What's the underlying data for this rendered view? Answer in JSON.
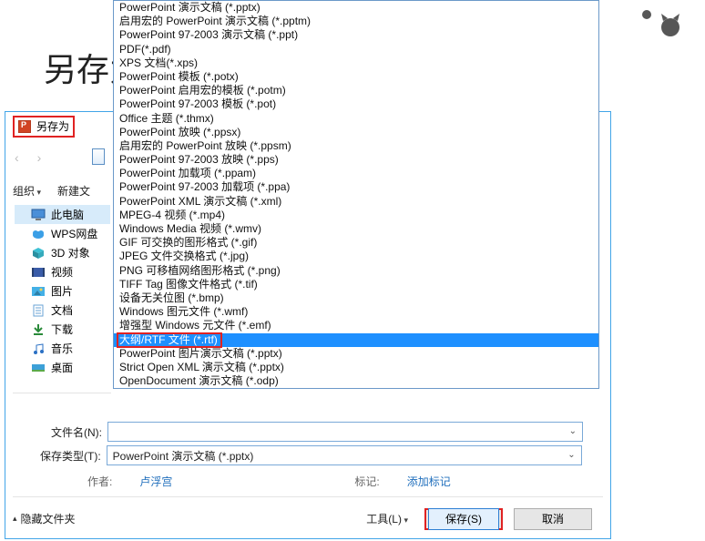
{
  "title": "另存为",
  "header_label": "另存为",
  "nav": {
    "back": "‹",
    "fwd": "›"
  },
  "toolbar": {
    "organize": "组织",
    "newfolder": "新建文"
  },
  "sidebar": [
    {
      "label": "此电脑",
      "icon": "pc"
    },
    {
      "label": "WPS网盘",
      "icon": "cloud"
    },
    {
      "label": "3D 对象",
      "icon": "cube"
    },
    {
      "label": "视频",
      "icon": "vid"
    },
    {
      "label": "图片",
      "icon": "pic"
    },
    {
      "label": "文档",
      "icon": "doc"
    },
    {
      "label": "下载",
      "icon": "dl"
    },
    {
      "label": "音乐",
      "icon": "mus"
    },
    {
      "label": "桌面",
      "icon": "desk"
    }
  ],
  "filename_label": "文件名(N):",
  "filetype_label": "保存类型(T):",
  "filetype_value": "PowerPoint 演示文稿 (*.pptx)",
  "meta": {
    "author_l": "作者:",
    "author_v": "卢浮宫",
    "tag_l": "标记:",
    "tag_v": "添加标记"
  },
  "bottom": {
    "hide": "隐藏文件夹",
    "tools": "工具(L)",
    "save": "保存(S)",
    "cancel": "取消"
  },
  "dropdown": [
    "PowerPoint 演示文稿 (*.pptx)",
    "启用宏的 PowerPoint 演示文稿 (*.pptm)",
    "PowerPoint 97-2003 演示文稿 (*.ppt)",
    "PDF(*.pdf)",
    "XPS 文档(*.xps)",
    "PowerPoint 模板 (*.potx)",
    "PowerPoint 启用宏的模板 (*.potm)",
    "PowerPoint 97-2003 模板 (*.pot)",
    "Office 主题 (*.thmx)",
    "PowerPoint 放映 (*.ppsx)",
    "启用宏的 PowerPoint 放映 (*.ppsm)",
    "PowerPoint 97-2003 放映 (*.pps)",
    "PowerPoint 加载项 (*.ppam)",
    "PowerPoint 97-2003 加载项 (*.ppa)",
    "PowerPoint XML 演示文稿 (*.xml)",
    "MPEG-4 视频 (*.mp4)",
    "Windows Media 视频 (*.wmv)",
    "GIF 可交换的图形格式 (*.gif)",
    "JPEG 文件交换格式 (*.jpg)",
    "PNG 可移植网络图形格式 (*.png)",
    "TIFF Tag 图像文件格式 (*.tif)",
    "设备无关位图 (*.bmp)",
    "Windows 图元文件 (*.wmf)",
    "增强型 Windows 元文件 (*.emf)",
    "大纲/RTF 文件 (*.rtf)",
    "PowerPoint 图片演示文稿 (*.pptx)",
    "Strict Open XML 演示文稿 (*.pptx)",
    "OpenDocument 演示文稿 (*.odp)"
  ],
  "selected_index": 24,
  "highlight_text": "大纲/RTF 文件 (*.rtf)"
}
